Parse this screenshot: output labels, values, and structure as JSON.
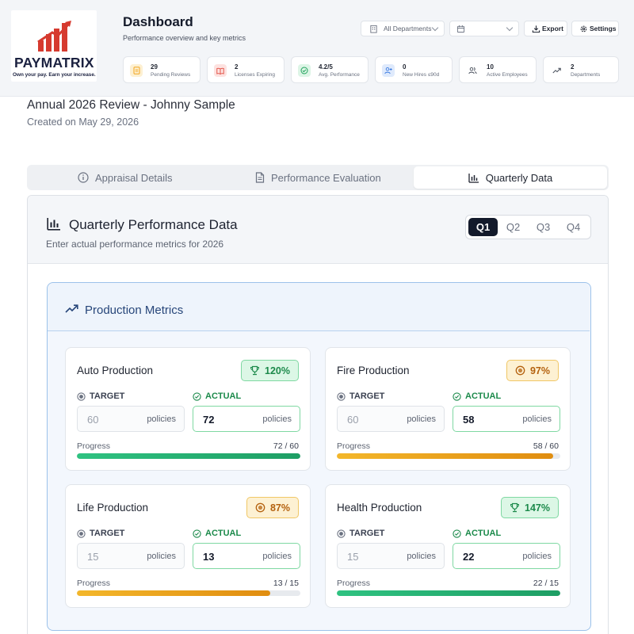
{
  "brand": {
    "name": "PAYMATRIX",
    "tagline": "Own your pay. Earn your increase.",
    "logo_color": "#d63a2f",
    "text_color": "#1b2140"
  },
  "header": {
    "title": "Dashboard",
    "subtitle": "Performance overview and key metrics",
    "department_filter": "All Departments",
    "export_label": "Export",
    "settings_label": "Settings"
  },
  "stats": [
    {
      "value": "29",
      "label": "Pending Reviews",
      "icon": "document-icon",
      "color": "#f2a41c"
    },
    {
      "value": "2",
      "label": "Licenses Expiring",
      "icon": "book-icon",
      "color": "#e0483c"
    },
    {
      "value": "4.2/5",
      "label": "Avg. Performance",
      "icon": "check-circle-icon",
      "color": "#22a45d"
    },
    {
      "value": "0",
      "label": "New Hires ≤90d",
      "icon": "user-plus-icon",
      "color": "#3a7be0"
    },
    {
      "value": "10",
      "label": "Active Employees",
      "icon": "users-icon",
      "color": "#444b58"
    },
    {
      "value": "2",
      "label": "Departments",
      "icon": "trend-up-icon",
      "color": "#444b58"
    }
  ],
  "review": {
    "title": "Annual 2026 Review - Johnny Sample",
    "created": "Created on May 29, 2026"
  },
  "tabs": [
    {
      "label": "Appraisal Details",
      "icon": "info-icon",
      "active": false
    },
    {
      "label": "Performance Evaluation",
      "icon": "document-icon",
      "active": false
    },
    {
      "label": "Quarterly Data",
      "icon": "bar-chart-icon",
      "active": true
    }
  ],
  "quarterly": {
    "title": "Quarterly Performance Data",
    "subtitle": "Enter actual performance metrics for 2026",
    "quarters": [
      "Q1",
      "Q2",
      "Q3",
      "Q4"
    ],
    "selected_quarter": "Q1"
  },
  "production": {
    "title": "Production Metrics",
    "target_label": "TARGET",
    "actual_label": "ACTUAL",
    "progress_label": "Progress",
    "unit": "policies",
    "metrics": [
      {
        "name": "Auto Production",
        "target": "60",
        "actual": "72",
        "percent": "120%",
        "progress_text": "72 / 60",
        "fraction": 1.0,
        "status": "good"
      },
      {
        "name": "Fire Production",
        "target": "60",
        "actual": "58",
        "percent": "97%",
        "progress_text": "58 / 60",
        "fraction": 0.967,
        "status": "warn"
      },
      {
        "name": "Life Production",
        "target": "15",
        "actual": "13",
        "percent": "87%",
        "progress_text": "13 / 15",
        "fraction": 0.867,
        "status": "warn"
      },
      {
        "name": "Health Production",
        "target": "15",
        "actual": "22",
        "percent": "147%",
        "progress_text": "22 / 15",
        "fraction": 1.0,
        "status": "good"
      }
    ]
  },
  "colors": {
    "good": "#1c8a4b",
    "warn": "#b4610e",
    "accent": "#27467a",
    "active_quarter": "#131a2b"
  }
}
